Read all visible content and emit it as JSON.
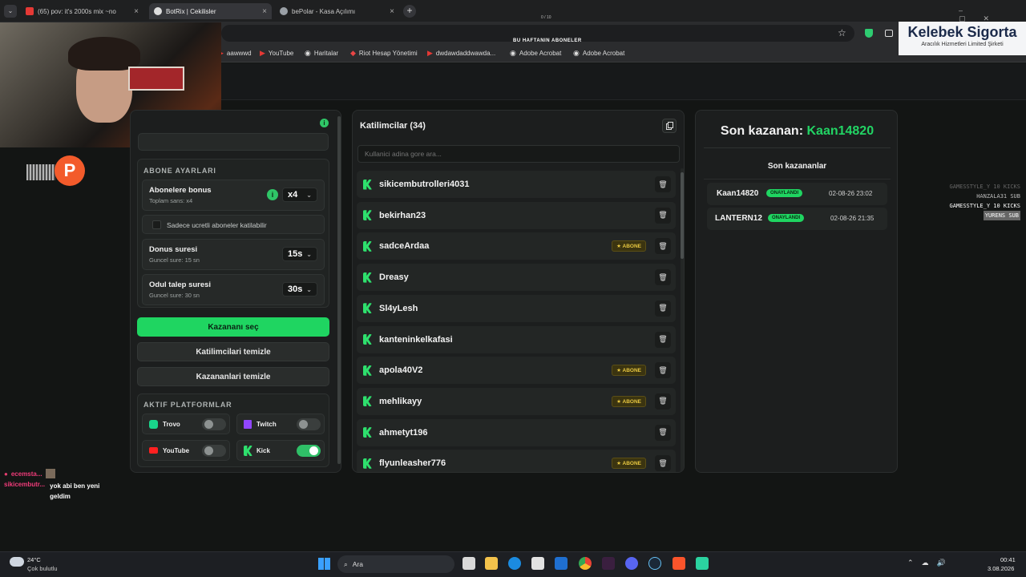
{
  "browser": {
    "tabs": [
      {
        "title": "(65) pov: it's 2000s mix ~no",
        "color": "#e53935"
      },
      {
        "title": "BotRix | Cekilisler",
        "color": "#dddddd"
      },
      {
        "title": "bePolar - Kasa Açılımı",
        "color": "#9aa0a6"
      }
    ],
    "center_counter": "0 / 10",
    "bookmarks": [
      "aawwwd",
      "YouTube",
      "Haritalar",
      "Riot Hesap Yönetimi",
      "dwdawdaddwawda...",
      "Adobe Acrobat",
      "Adobe Acrobat"
    ]
  },
  "overlay": {
    "subs_title": "BU HAFTANIN ABONELER",
    "sponsor_title": "Kelebek Sigorta",
    "sponsor_sub": "Aracılık Hizmetleri Limited Şirketi",
    "alerts": [
      "GAMESSTYLE_Y 10 KICKS",
      "HANZALA31 SUB",
      "GAMESSTYLE_Y 10 KICKS",
      "YURENS SUB"
    ],
    "chat": [
      {
        "user": "ecemsta...",
        "text": ""
      },
      {
        "user": "sikicembutr...",
        "text": "yok abi ben yeni geldim"
      }
    ]
  },
  "settings": {
    "section_title": "ABONE AYARLARI",
    "bonus_label": "Abonelere bonus",
    "bonus_sub": "Toplam sans: x4",
    "bonus_value": "x4",
    "only_paid_label": "Sadece ucretli aboneler katilabilir",
    "donus_label": "Donus suresi",
    "donus_sub": "Guncel sure: 15 sn",
    "donus_value": "15s",
    "odul_label": "Odul talep suresi",
    "odul_sub": "Guncel sure: 30 sn",
    "odul_value": "30s",
    "pick_winner": "Kazananı seç",
    "clear_participants": "Katilimcilari temizle",
    "clear_winners": "Kazananlari temizle",
    "platforms_title": "AKTIF PLATFORMLAR",
    "platforms": [
      {
        "name": "Trovo",
        "on": false,
        "color": "#19d48a"
      },
      {
        "name": "Twitch",
        "on": false,
        "color": "#9146ff"
      },
      {
        "name": "YouTube",
        "on": false,
        "color": "#ff2020"
      },
      {
        "name": "Kick",
        "on": true,
        "color": "#2ee06d"
      }
    ]
  },
  "participants": {
    "title": "Katilimcilar (34)",
    "search_placeholder": "Kullanici adina gore ara...",
    "abone_label": "ABONE",
    "list": [
      {
        "name": "sikicembutrolleri4031",
        "abone": false
      },
      {
        "name": "bekirhan23",
        "abone": false
      },
      {
        "name": "sadceArdaa",
        "abone": true
      },
      {
        "name": "Dreasy",
        "abone": false
      },
      {
        "name": "Sl4yLesh",
        "abone": false
      },
      {
        "name": "kanteninkelkafasi",
        "abone": false
      },
      {
        "name": "apola40V2",
        "abone": true
      },
      {
        "name": "mehlikayy",
        "abone": true
      },
      {
        "name": "ahmetyt196",
        "abone": false
      },
      {
        "name": "flyunleasher776",
        "abone": true
      }
    ]
  },
  "winners": {
    "last_label": "Son kazanan:",
    "last_name": "Kaan14820",
    "list_title": "Son kazananlar",
    "list": [
      {
        "name": "Kaan14820",
        "status": "ONAYLANDI",
        "date": "02-08-26 23:02"
      },
      {
        "name": "LANTERN12",
        "status": "ONAYLANDI",
        "date": "02-08-26 21:35"
      }
    ]
  },
  "taskbar": {
    "temp": "24°C",
    "weather": "Çok bulutlu",
    "search": "Ara",
    "time": "00:41",
    "date": "3.08.2026"
  }
}
